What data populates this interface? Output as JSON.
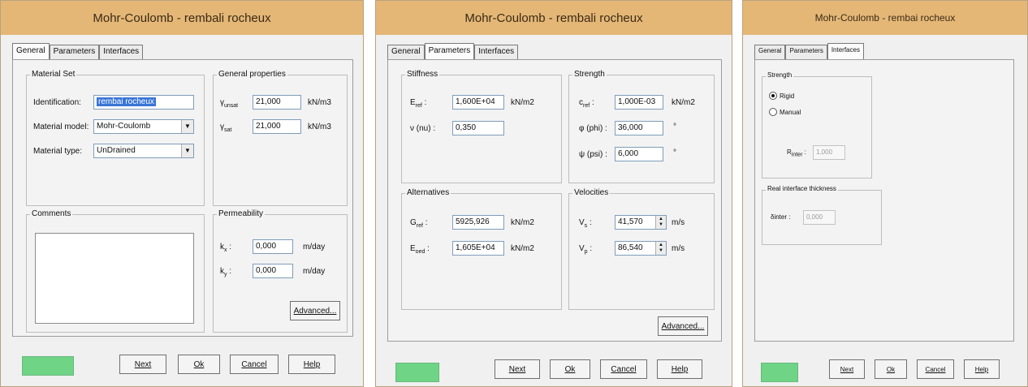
{
  "dialog_title": "Mohr-Coulomb - rembali rocheux",
  "dialog3_title": "Mohr-Coulomb - rembai rocheux",
  "tabs": {
    "general": "General",
    "parameters": "Parameters",
    "interfaces": "Interfaces"
  },
  "buttons": {
    "next": "Next",
    "ok": "Ok",
    "cancel": "Cancel",
    "help": "Help",
    "advanced": "Advanced..."
  },
  "colors": {
    "titlebar": "#e4b777",
    "green_indicator": "#6fd486"
  },
  "general": {
    "material_set": {
      "title": "Material Set",
      "identification_label": "Identification:",
      "identification_value": "rembai rocheux",
      "model_label": "Material model:",
      "model_value": "Mohr-Coulomb",
      "type_label": "Material type:",
      "type_value": "UnDrained"
    },
    "general_properties": {
      "title": "General properties",
      "gamma_unsat": "21,000",
      "gamma_sat": "21,000",
      "unit": "kN/m3"
    },
    "comments_title": "Comments",
    "permeability": {
      "title": "Permeability",
      "kx_value": "0,000",
      "ky_value": "0,000",
      "unit": "m/day"
    }
  },
  "parameters": {
    "stiffness": {
      "title": "Stiffness",
      "eref_value": "1,600E+04",
      "nu_label": "ν (nu) :",
      "nu_value": "0,350",
      "unit": "kN/m2"
    },
    "strength": {
      "title": "Strength",
      "cref_value": "1,000E-03",
      "phi_label": "φ (phi) :",
      "phi_value": "36,000",
      "psi_label": "ψ (psi) :",
      "psi_value": "6,000",
      "c_unit": "kN/m2",
      "deg": "°"
    },
    "alternatives": {
      "title": "Alternatives",
      "gref_value": "5925,926",
      "eoed_value": "1,605E+04",
      "unit": "kN/m2"
    },
    "velocities": {
      "title": "Velocities",
      "vs_value": "41,570",
      "vp_value": "86,540",
      "unit": "m/s"
    }
  },
  "interfaces": {
    "strength_title": "Strength",
    "rigid_label": "Rigid",
    "manual_label": "Manual",
    "rinter_value": "1,000",
    "thickness_title": "Real interface thickness",
    "delta_label": "δinter :",
    "delta_value": "0,000"
  }
}
